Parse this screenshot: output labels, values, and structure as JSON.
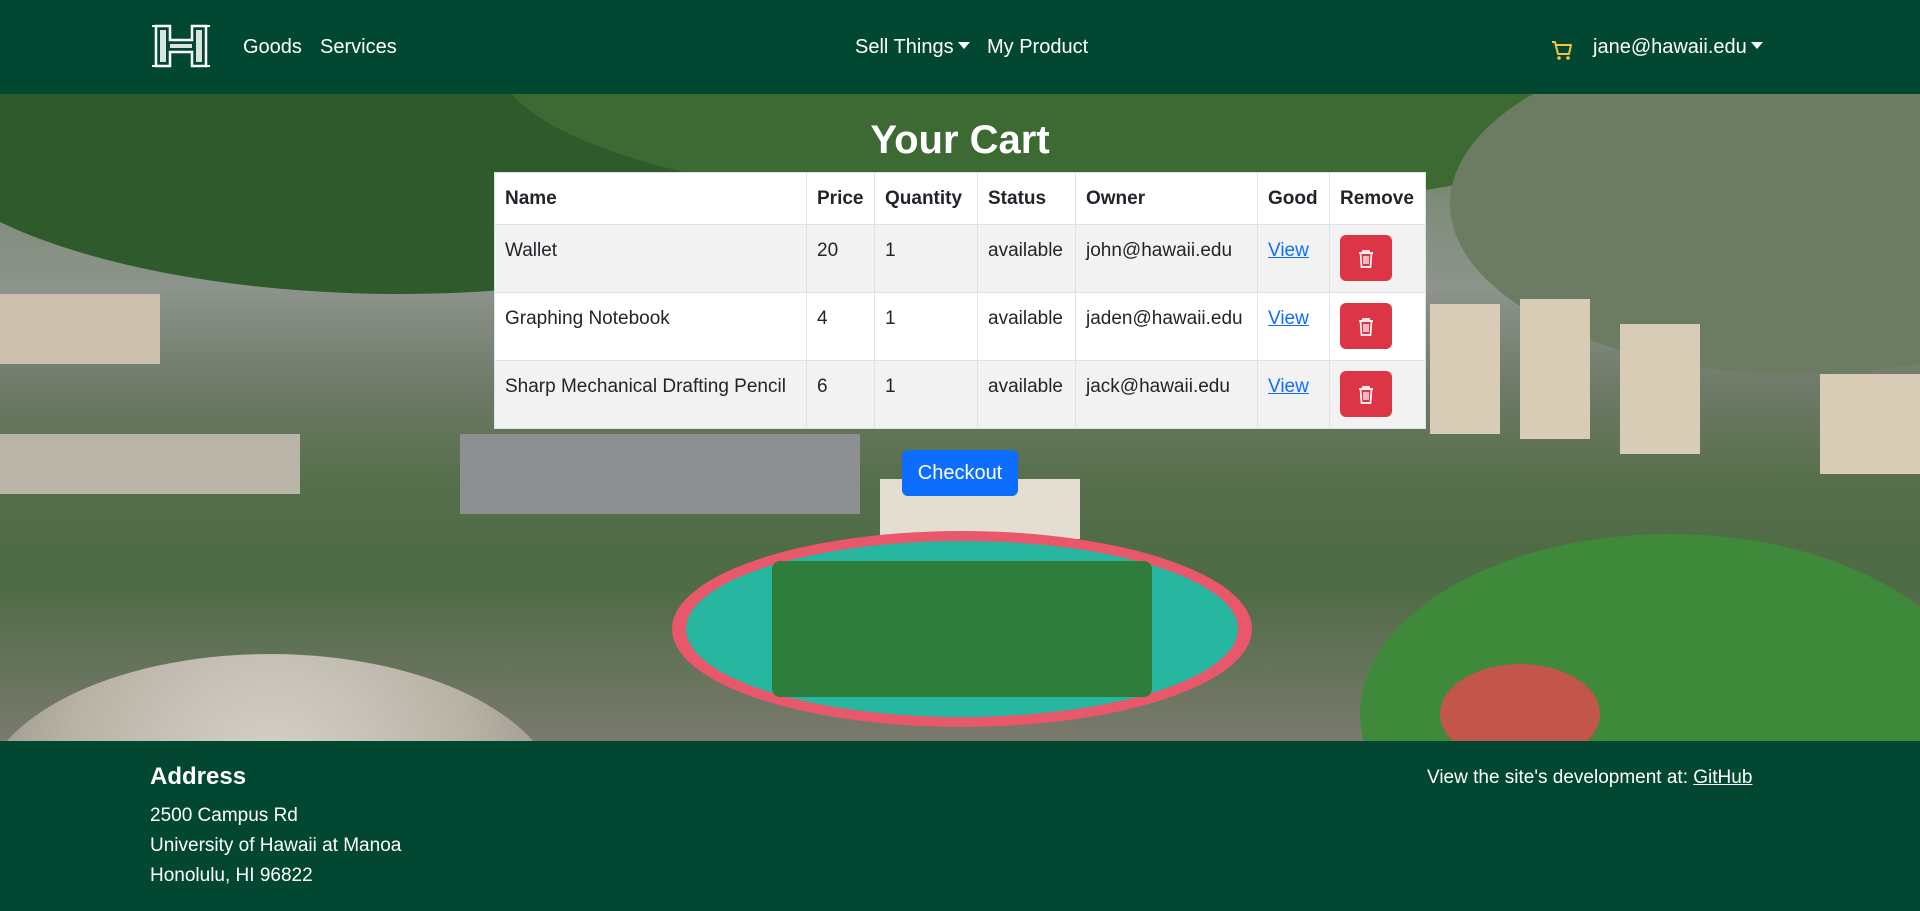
{
  "navbar": {
    "brand_alt": "H",
    "links": {
      "goods": "Goods",
      "services": "Services",
      "sell_things": "Sell Things",
      "my_product": "My Product",
      "user": "jane@hawaii.edu"
    },
    "icons": {
      "cart": "cart-icon",
      "logo": "logo-icon"
    }
  },
  "cart": {
    "title": "Your Cart",
    "headers": [
      "Name",
      "Price",
      "Quantity",
      "Status",
      "Owner",
      "Good",
      "Remove"
    ],
    "rows": [
      {
        "name": "Wallet",
        "price": "20",
        "quantity": "1",
        "status": "available",
        "owner": "john@hawaii.edu",
        "good": "View"
      },
      {
        "name": "Graphing Notebook",
        "price": "4",
        "quantity": "1",
        "status": "available",
        "owner": "jaden@hawaii.edu",
        "good": "View"
      },
      {
        "name": "Sharp Mechanical Drafting Pencil",
        "price": "6",
        "quantity": "1",
        "status": "available",
        "owner": "jack@hawaii.edu",
        "good": "View"
      }
    ],
    "checkout_label": "Checkout"
  },
  "footer": {
    "address_title": "Address",
    "address_lines": [
      "2500 Campus Rd",
      "University of Hawaii at Manoa",
      "Honolulu, HI 96822"
    ],
    "dev_text": "View the site's development at: ",
    "github_label": "GitHub"
  },
  "colors": {
    "brand_green": "#024731",
    "primary": "#0d6efd",
    "danger": "#dc3545"
  }
}
